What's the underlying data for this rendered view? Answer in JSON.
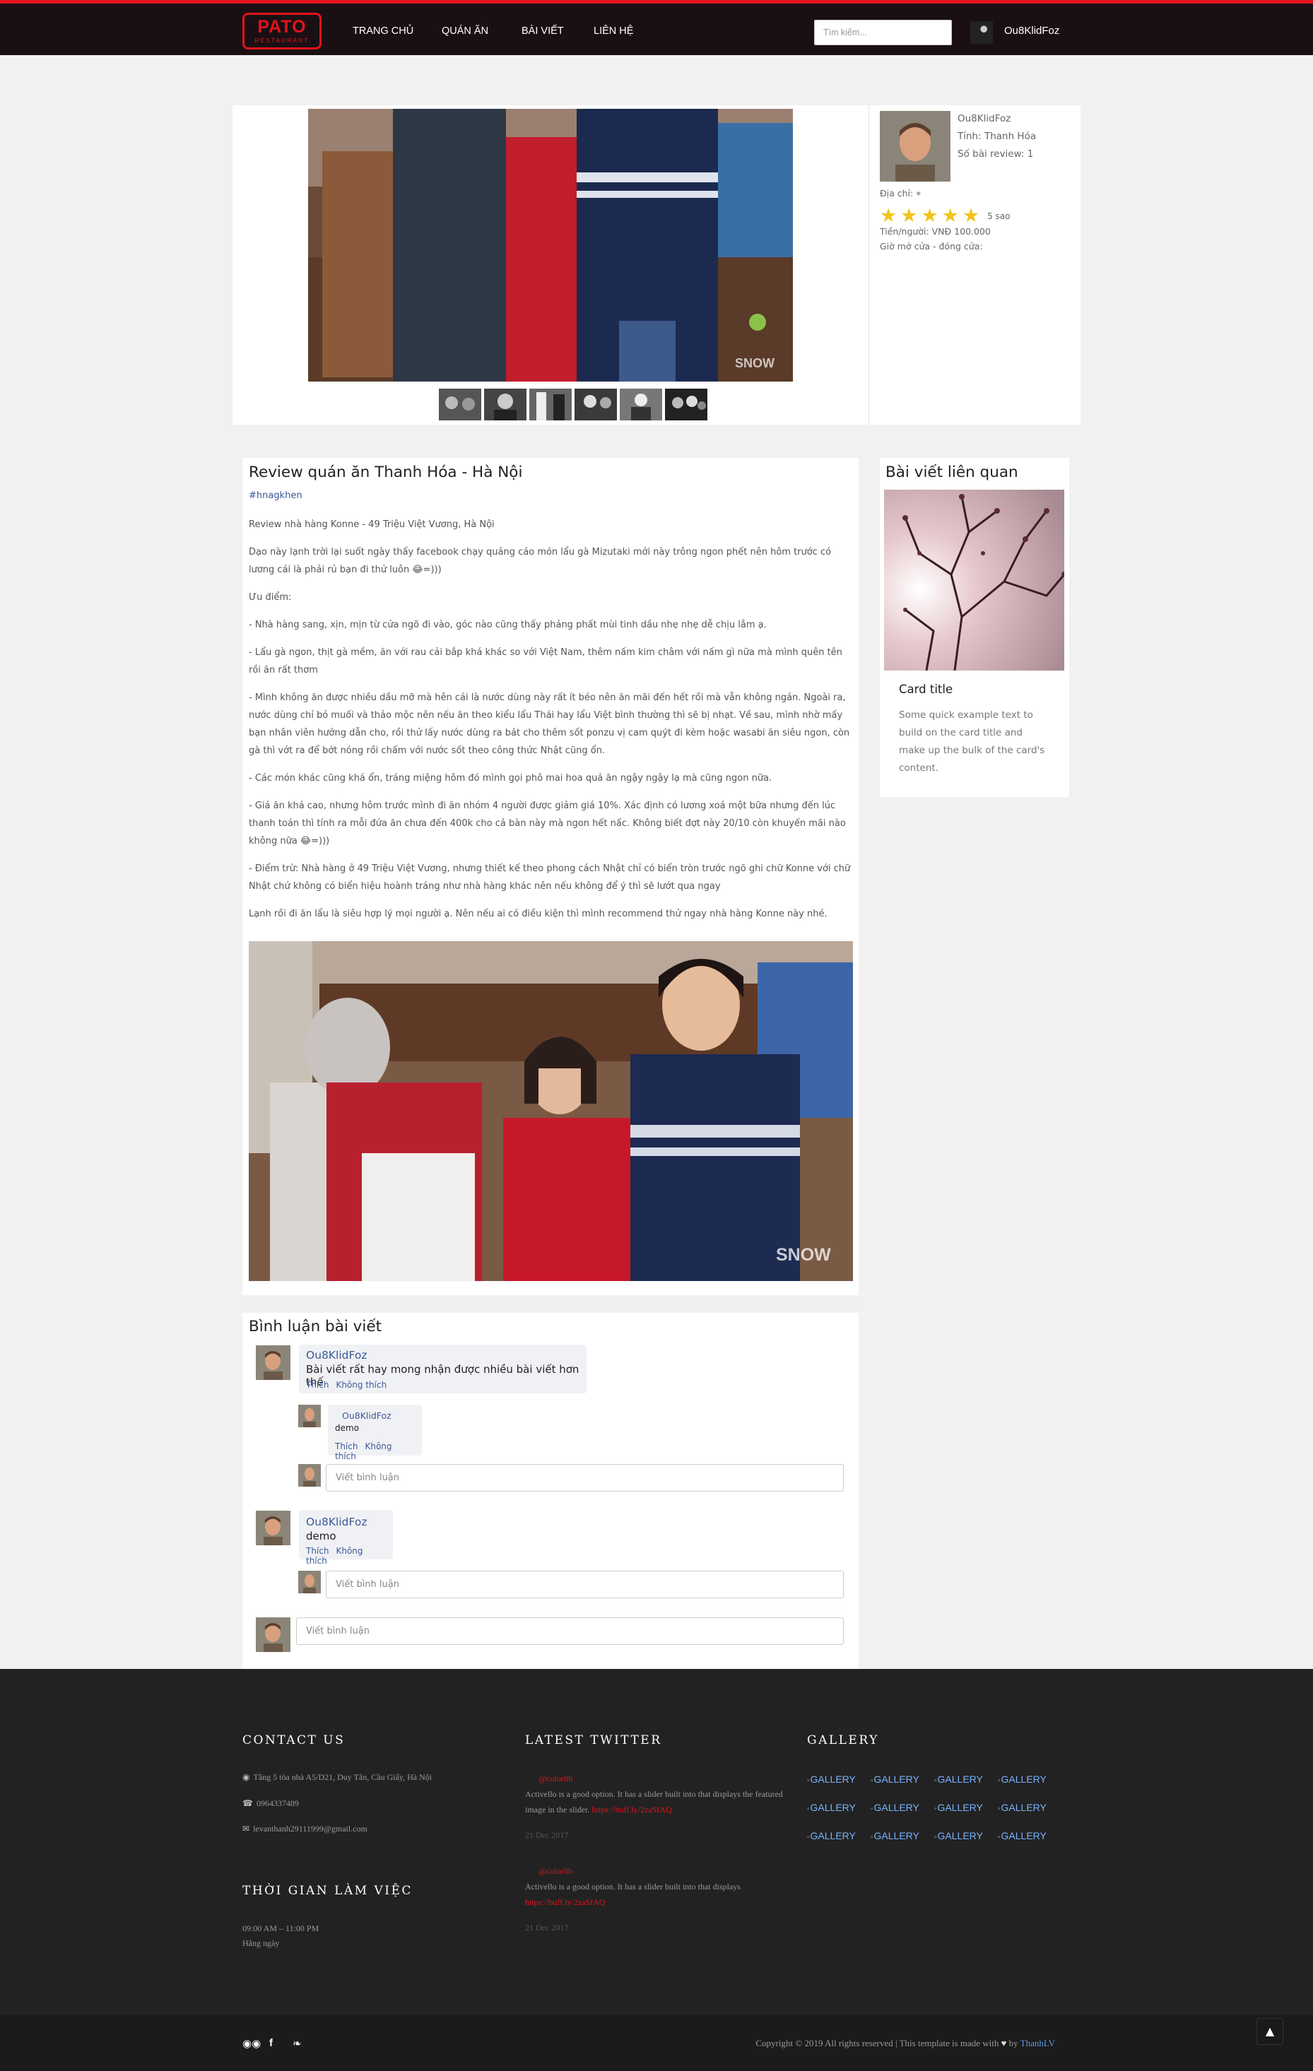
{
  "header": {
    "logo_main": "PATO",
    "logo_sub": "RESTAURANT",
    "nav": [
      "TRANG CHỦ",
      "QUÁN ĂN",
      "BÀI VIẾT",
      "LIÊN HỆ"
    ],
    "search_placeholder": "Tìm kiếm...",
    "user_name": "Ou8KlidFoz"
  },
  "post_info": {
    "author": "Ou8KlidFoz",
    "province": "Tỉnh: Thanh Hóa",
    "review_count": "Số bài review: 1",
    "address_label": "Địa chỉ:",
    "stars": 5,
    "stars_label": "5 sao",
    "price": "Tiền/người: VNĐ 100.000",
    "hours": "Giờ mở cửa - đóng cửa:"
  },
  "article": {
    "title": "Review quán ăn Thanh Hóa - Hà Nội",
    "tag": "#hnagkhen",
    "paragraphs": [
      "Review nhà hàng Konne - 49 Triệu Việt Vương, Hà Nội",
      "Dạo này lạnh trời lại suốt ngày thấy facebook chạy quảng cáo món lẩu gà Mizutaki mới này trông ngon phết nên hôm trước có lương cái là phải rủ bạn đi thử luôn 😂=)))",
      "Ưu điểm:",
      "- Nhà hàng sang, xịn, mịn từ cửa ngõ đi vào, góc nào cũng thấy phảng phất mùi tinh dầu nhẹ nhẹ dễ chịu lắm ạ.",
      "- Lẩu gà ngon, thịt gà mềm, ăn với rau cải bắp khá khác so với Việt Nam, thêm nấm kim châm với nấm gì nữa mà mình quên tên rồi ăn rất thơm",
      "- Mình không ăn được nhiều dầu mỡ mà hên cái là nước dùng này rất ít béo nên ăn mãi đến hết rồi mà vẫn không ngán. Ngoài ra, nước dùng chỉ bỏ muối và thảo mộc nên nếu ăn theo kiểu lẩu Thái hay lẩu Việt bình thường thì sẽ bị nhạt. Về sau, mình nhờ mấy bạn nhân viên hướng dẫn cho, rồi thử lấy nước dùng ra bát cho thêm sốt ponzu vị cam quýt đi kèm hoặc wasabi ăn siêu ngon, còn gà thì vớt ra để bớt nóng rồi chấm với nước sốt theo công thức Nhật cũng ổn.",
      "- Các món khác cũng khá ổn, tráng miệng hôm đó mình gọi phô mai hoa quả ăn ngậy ngậy lạ mà cũng ngon nữa.",
      "- Giá ăn khá cao, nhưng hôm trước mình đi ăn nhóm 4 người được giảm giá 10%. Xác định có lương xoá một bữa nhưng đến lúc thanh toán thì tính ra mỗi đứa ăn chưa đến 400k cho cả bàn này mà ngon hết nấc. Không biết đợt này 20/10 còn khuyến mãi nào không nữa 😂=)))",
      "- Điểm trừ: Nhà hàng ở 49 Triệu Việt Vương, nhưng thiết kế theo phong cách Nhật chỉ có biển tròn trước ngõ ghi chữ Konne với chữ Nhật chứ không có biển hiệu hoành tráng như nhà hàng khác nên nếu không để ý thì sẽ lướt qua ngay",
      "Lạnh rồi đi ăn lẩu là siêu hợp lý mọi người ạ. Nên nếu ai có điều kiện thì mình recommend thử ngay nhà hàng Konne này nhé."
    ]
  },
  "related": {
    "heading": "Bài viết liên quan",
    "card_title": "Card title",
    "card_text": "Some quick example text to build on the card title and make up the bulk of the card's content."
  },
  "comments": {
    "heading": "Bình luận bài viết",
    "like": "Thích",
    "unlike": "Không thích",
    "placeholder": "Viết bình luận",
    "items": [
      {
        "name": "Ou8KlidFoz",
        "text": "Bài viết rất hay mong nhận được nhiều bài viết hơn thế"
      },
      {
        "name": "Ou8KlidFoz",
        "text": "demo"
      },
      {
        "name": "Ou8KlidFoz",
        "text": "demo"
      }
    ]
  },
  "footer": {
    "contact_heading": "CONTACT US",
    "address": "Tầng 5 tòa nhà A5/D21, Duy Tân, Cầu Giấy, Hà Nội",
    "phone": "0964337489",
    "email": "levanthanh29111999@gmail.com",
    "hours_heading": "THỜI GIAN LÀM VIỆC",
    "hours_time": "09:00 AM – 11:00 PM",
    "hours_days": "Hằng ngày",
    "twitter_heading": "LATEST TWITTER",
    "tweets": [
      {
        "handle": "@colorlib",
        "text": "Activello is a good option. It has a slider built into that displays the featured image in the slider.",
        "link": "https://buff.ly/2zaSfAQ",
        "date": "21 Dec 2017"
      },
      {
        "handle": "@colorlib",
        "text": "Activello is a good option. It has a slider built into that displays",
        "link": "https://buff.ly/2zaSfAQ",
        "date": "21 Dec 2017"
      }
    ],
    "gallery_heading": "GALLERY",
    "gallery_alt": "GALLERY",
    "copyright_pre": "Copyright © 2019 All rights reserved | This template is made with",
    "copyright_by": "by",
    "copyright_author": "ThanhLV"
  },
  "icons": {
    "location": "map-marker-icon",
    "phone": "phone-icon",
    "email": "envelope-icon",
    "social": [
      "tripadvisor-icon",
      "facebook-icon",
      "twitter-icon"
    ],
    "back_to_top": "double-chevron-up-icon"
  },
  "colors": {
    "accent": "#e3131b",
    "link": "#3b5998",
    "star": "#f0c419",
    "header_bg": "#1a1014",
    "footer_bg": "#222222"
  }
}
